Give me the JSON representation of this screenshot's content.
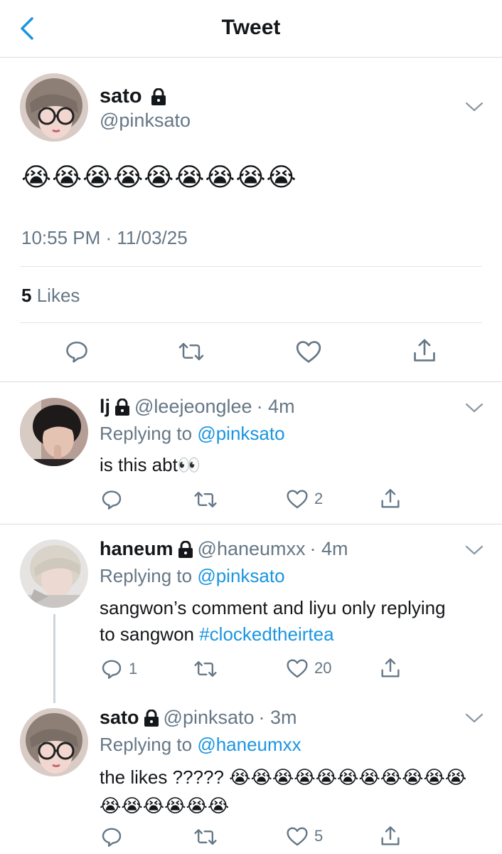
{
  "header": {
    "title": "Tweet"
  },
  "main_tweet": {
    "name": "sato",
    "handle": "@pinksato",
    "text": "😭😭😭😭😭😭😭😭😭",
    "timestamp": "10:55 PM · 11/03/25",
    "likes_count": "5",
    "likes_label": "Likes"
  },
  "replies": [
    {
      "name": "lj",
      "handle": "@leejeonglee",
      "time": "· 4m",
      "replying_label": "Replying to",
      "replying_to": "@pinksato",
      "text": "is this abt👀",
      "tag": "",
      "reply_count": "",
      "like_count": "2"
    },
    {
      "name": "haneum",
      "handle": "@haneumxx",
      "time": "· 4m",
      "replying_label": "Replying to",
      "replying_to": "@pinksato",
      "text": "sangwon’s comment and liyu only replying to sangwon ",
      "tag": "#clockedtheirtea",
      "reply_count": "1",
      "like_count": "20"
    },
    {
      "name": "sato",
      "handle": "@pinksato",
      "time": "· 3m",
      "replying_label": "Replying to",
      "replying_to": "@haneumxx",
      "text": "the likes ????? 😭😭😭😭😭😭😭😭😭😭😭😭😭😭😭😭😭",
      "tag": "",
      "reply_count": "",
      "like_count": "5"
    }
  ],
  "colors": {
    "accent": "#1b95e0",
    "secondary_text": "#657786",
    "primary_text": "#14171a",
    "divider": "#e1e4e7"
  },
  "icons": [
    "back-chevron-icon",
    "lock-icon",
    "chevron-down-icon",
    "reply-icon",
    "retweet-icon",
    "like-icon",
    "share-icon"
  ]
}
